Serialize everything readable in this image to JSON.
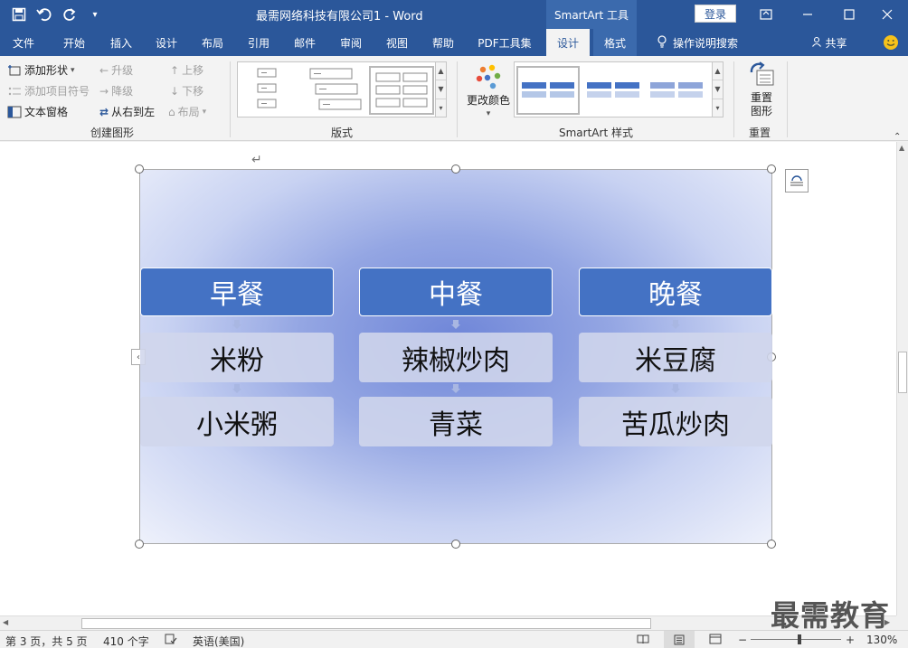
{
  "app": {
    "title": "最需网络科技有限公司1 - Word",
    "tools_tab": "SmartArt 工具",
    "login": "登录"
  },
  "tabs": [
    "文件",
    "开始",
    "插入",
    "设计",
    "布局",
    "引用",
    "邮件",
    "审阅",
    "视图",
    "帮助",
    "PDF工具集",
    "设计",
    "格式"
  ],
  "tell_me": "操作说明搜索",
  "share": "共享",
  "ribbon": {
    "create": {
      "add_shape": "添加形状",
      "add_bullet": "添加项目符号",
      "text_pane": "文本窗格",
      "promote": "升级",
      "demote": "降级",
      "rtl": "从右到左",
      "move_up": "上移",
      "move_down": "下移",
      "layout": "布局",
      "label": "创建图形"
    },
    "layouts_label": "版式",
    "change_colors": "更改颜色",
    "styles_label": "SmartArt 样式",
    "reset_graphic": "重置\n图形",
    "reset_label": "重置"
  },
  "smartart": {
    "columns": [
      {
        "head": "早餐",
        "items": [
          "米粉",
          "小米粥"
        ]
      },
      {
        "head": "中餐",
        "items": [
          "辣椒炒肉",
          "青菜"
        ]
      },
      {
        "head": "晚餐",
        "items": [
          "米豆腐",
          "苦瓜炒肉"
        ]
      }
    ]
  },
  "status": {
    "page": "第 3 页，共 5 页",
    "words": "410 个字",
    "lang": "英语(美国)",
    "zoom": "130%"
  },
  "watermark": "最需教育",
  "colors": {
    "brand": "#2b579a",
    "node": "#4472c4"
  }
}
